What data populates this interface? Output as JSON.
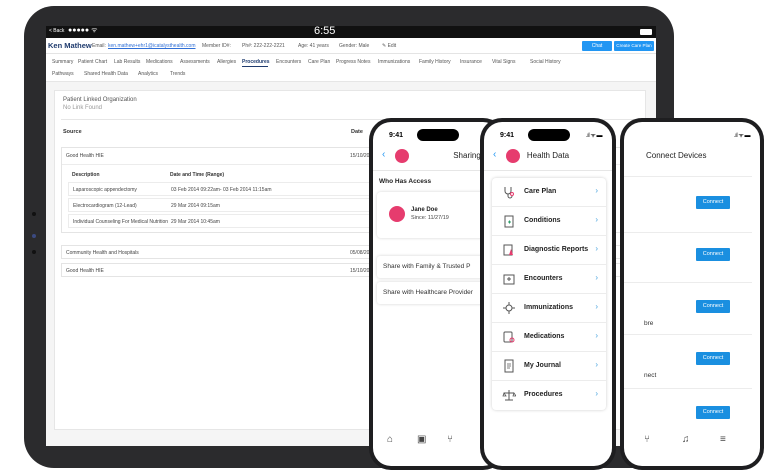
{
  "tablet": {
    "status": {
      "back": "< Back",
      "signal": "●●●●● ᯤ",
      "time": "6:55"
    },
    "patient": {
      "name": "Ken Mathew",
      "email_label": "Email:",
      "email": "ken.mathew+ehr1@icatalysthealth.com",
      "member_id": "Member ID#:",
      "phone": "Ph#: 222-222-2221",
      "age": "Age: 41 years",
      "gender": "Gender: Male",
      "edit": "✎ Edit",
      "chat_button": "Chat",
      "care_plan_button": "Create Care Plan"
    },
    "tabs_row1": [
      "Summary",
      "Patient Chart",
      "Lab Results",
      "Medications",
      "Assessments",
      "Allergies",
      "Procedures",
      "Encounters",
      "Care Plan",
      "Progress Notes",
      "Immunizations",
      "Family History",
      "Insurance",
      "Vital Signs",
      "Social History"
    ],
    "tabs_row2": [
      "Pathways",
      "Shared Health Data",
      "Analytics",
      "Trends"
    ],
    "active_tab": "Procedures",
    "plo_label": "Patient Linked Organization",
    "plo_value": "No Link Found",
    "source_header": "Source",
    "date_header": "Date",
    "rows": [
      {
        "source": "Good Health HIE",
        "date": "15/10/2014"
      },
      {
        "source": "Community Health and Hospitals",
        "date": "05/08/2009"
      },
      {
        "source": "Good Health HIE",
        "date": "15/10/2014"
      }
    ],
    "sub_headers": {
      "description": "Description",
      "datetime": "Date and Time (Range)"
    },
    "sub_rows": [
      {
        "description": "Laparoscopic appendectomy",
        "datetime": "03 Feb 2014 09:22am- 03 Feb 2014 11:15am"
      },
      {
        "description": "Electrocardiogram (12-Lead)",
        "datetime": "29 Mar 2014 09:15am"
      },
      {
        "description": "Individual Counseling For Medical Nutrition",
        "datetime": "29 Mar 2014 10:45am"
      }
    ]
  },
  "sharing_phone": {
    "time": "9:41",
    "title": "Sharing",
    "section": "Who Has Access",
    "contact_name": "Jane Doe",
    "contact_since": "Since: 11/27/19",
    "share_family": "Share with Family & Trusted P",
    "share_provider": "Share with Healthcare Provider"
  },
  "health_phone": {
    "time": "9:41",
    "status": ".ıl ᯤ ▬",
    "title": "Health Data",
    "items": [
      {
        "label": "Care Plan",
        "icon": "stethoscope-icon"
      },
      {
        "label": "Conditions",
        "icon": "clipboard-icon"
      },
      {
        "label": "Diagnostic Reports",
        "icon": "flask-icon"
      },
      {
        "label": "Encounters",
        "icon": "hospital-icon"
      },
      {
        "label": "Immunizations",
        "icon": "virus-icon"
      },
      {
        "label": "Medications",
        "icon": "pills-icon"
      },
      {
        "label": "My Journal",
        "icon": "journal-icon"
      },
      {
        "label": "Procedures",
        "icon": "scale-icon"
      }
    ]
  },
  "connect_phone": {
    "status": ".ıl ᯤ ▬",
    "title": "Connect Devices",
    "connect_label": "Connect",
    "partial_1": "bre",
    "partial_2": "nect"
  },
  "colors": {
    "accent": "#2196f3",
    "brand_pink": "#e63c6e",
    "navy": "#1f3b6e"
  }
}
